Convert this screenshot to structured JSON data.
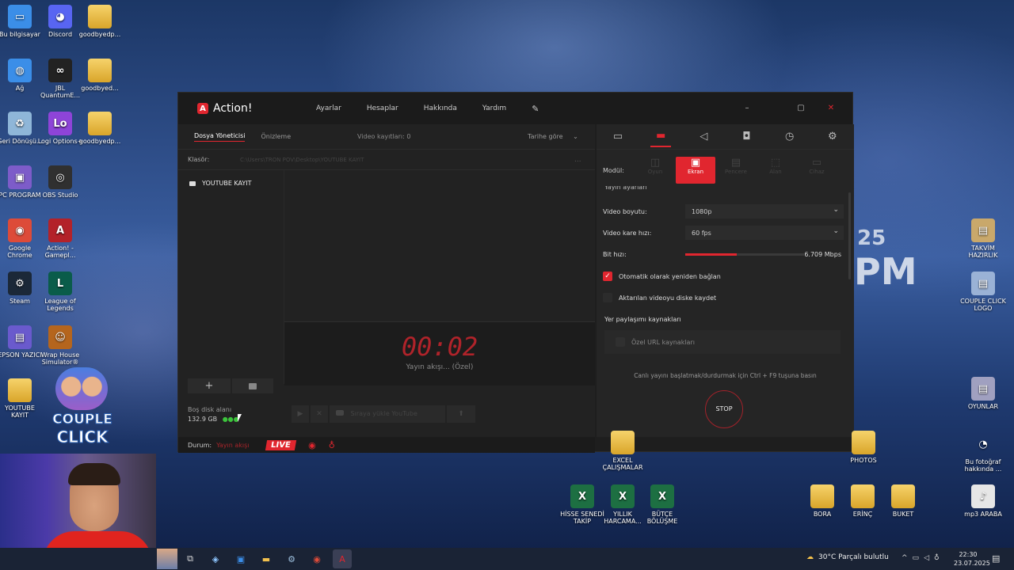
{
  "desktop": {
    "left_icons": [
      {
        "label": "Bu bilgisayar",
        "glyph": "▭",
        "color": "#3b8ee8"
      },
      {
        "label": "Ağ",
        "glyph": "◍",
        "color": "#3b8ee8"
      },
      {
        "label": "Geri Dönüşü...",
        "glyph": "♻",
        "color": "#8fb6d8"
      },
      {
        "label": "PC PROGRAM",
        "glyph": "▣",
        "color": "#7d5cc9"
      },
      {
        "label": "Google Chrome",
        "glyph": "◉",
        "color": "#dd4b39"
      },
      {
        "label": "Steam",
        "glyph": "⚙",
        "color": "#1b2838"
      },
      {
        "label": "EPSON YAZICI",
        "glyph": "▤",
        "color": "#6a5acd"
      },
      {
        "label": "YOUTUBE KAYIT",
        "glyph": "",
        "color": "folder"
      }
    ],
    "col2_icons": [
      {
        "label": "Discord",
        "glyph": "◕",
        "color": "#5865f2"
      },
      {
        "label": "JBL QuantumE...",
        "glyph": "∞",
        "color": "#222"
      },
      {
        "label": "Logi Options+",
        "glyph": "Lo",
        "color": "#8e44d8"
      },
      {
        "label": "OBS Studio",
        "glyph": "◎",
        "color": "#303030"
      },
      {
        "label": "Action! - Gamepl...",
        "glyph": "A",
        "color": "#b32229"
      },
      {
        "label": "League of Legends",
        "glyph": "L",
        "color": "#0a5c4a"
      },
      {
        "label": "Wrap House Simulator®",
        "glyph": "☺",
        "color": "#b5651d"
      }
    ],
    "col3_icons": [
      {
        "label": "goodbyedp...",
        "glyph": "",
        "color": "folder"
      },
      {
        "label": "goodbyed...",
        "glyph": "",
        "color": "folder"
      },
      {
        "label": "goodbyedp...",
        "glyph": "",
        "color": "folder"
      }
    ],
    "right_icons": [
      {
        "label": "TAKVİM HAZIRLIK",
        "glyph": "▤",
        "color": "#c9a86b"
      },
      {
        "label": "COUPLE CLICK LOGO",
        "glyph": "▤",
        "color": "#9ab2d6"
      },
      {
        "label": "OYUNLAR",
        "glyph": "▤",
        "color": "#a0a0c0"
      },
      {
        "label": "Bu fotoğraf hakkında ...",
        "glyph": "◔",
        "color": "transparent"
      }
    ],
    "bottom_icons": [
      {
        "label": "PHOTOS",
        "glyph": "",
        "color": "folder"
      },
      {
        "label": "EXCEL ÇALIŞMALAR",
        "glyph": "",
        "color": "folder"
      },
      {
        "label": "HİSSE SENEDİ TAKİP",
        "glyph": "X",
        "color": "#1d6f42"
      },
      {
        "label": "YILLIK HARCAMA...",
        "glyph": "X",
        "color": "#1d6f42"
      },
      {
        "label": "BÜTÇE BÖLÜŞME",
        "glyph": "X",
        "color": "#1d6f42"
      },
      {
        "label": "BORA",
        "glyph": "",
        "color": "folder"
      },
      {
        "label": "ERİNÇ",
        "glyph": "",
        "color": "folder"
      },
      {
        "label": "BUKET",
        "glyph": "",
        "color": "folder"
      },
      {
        "label": "mp3 ARABA",
        "glyph": "♪",
        "color": "#e6e6e6"
      }
    ],
    "wall_text_1": "25",
    "wall_text_2": "PM",
    "couple_logo_1": "COUPLE",
    "couple_logo_2": "CLICK"
  },
  "app": {
    "title": "Action!",
    "nav": [
      "Ayarlar",
      "Hesaplar",
      "Hakkında",
      "Yardım"
    ],
    "window_controls": {
      "minimize": "–",
      "maximize": "▢",
      "close": "✕"
    },
    "left": {
      "tabs": [
        "Dosya Yöneticisi",
        "Önizleme"
      ],
      "video_count": "Video kayıtları: 0",
      "sort": "Tarihe göre",
      "folder_label": "Klasör:",
      "folder_path": "C:\\Users\\TRON POV\\Desktop\\YOUTUBE KAYIT",
      "folder_more": "...",
      "folders": [
        "YOUTUBE KAYIT"
      ],
      "add": "+",
      "disk_label": "Boş disk alanı",
      "disk_value": "132.9 GB",
      "timer": "00:02",
      "stream_status": "Yayın akışı... (Özel)",
      "upload_label": "Sıraya yükle YouTube"
    },
    "status": {
      "label": "Durum:",
      "value": "Yayın akışı",
      "live": "LIVE"
    },
    "right": {
      "module_label": "Modül:",
      "modules": [
        "Oyun",
        "Ekran",
        "Pencere",
        "Alan",
        "Cihaz"
      ],
      "active_module": "Ekran",
      "section_title": "Yayın ayarları",
      "video_size_label": "Video boyutu:",
      "video_size": "1080p",
      "fps_label": "Video kare hızı:",
      "fps": "60 fps",
      "bitrate_label": "Bit hızı:",
      "bitrate": "6.709 Mbps",
      "bitrate_level": 0.43,
      "reconnect_label": "Otomatik olarak yeniden bağlan",
      "reconnect_checked": true,
      "save_label": "Aktarılan videoyu diske kaydet",
      "save_checked": false,
      "sources_title": "Yer paylaşımı kaynakları",
      "custom_url": "Özel URL kaynakları",
      "hint": "Canlı yayını başlatmak/durdurmak için Ctrl + F9 tuşuna basın",
      "stop": "STOP"
    }
  },
  "taskbar": {
    "weather": "30°C  Parçalı bulutlu",
    "time": "22:30",
    "date": "23.07.2025",
    "lang_icon": "^"
  }
}
